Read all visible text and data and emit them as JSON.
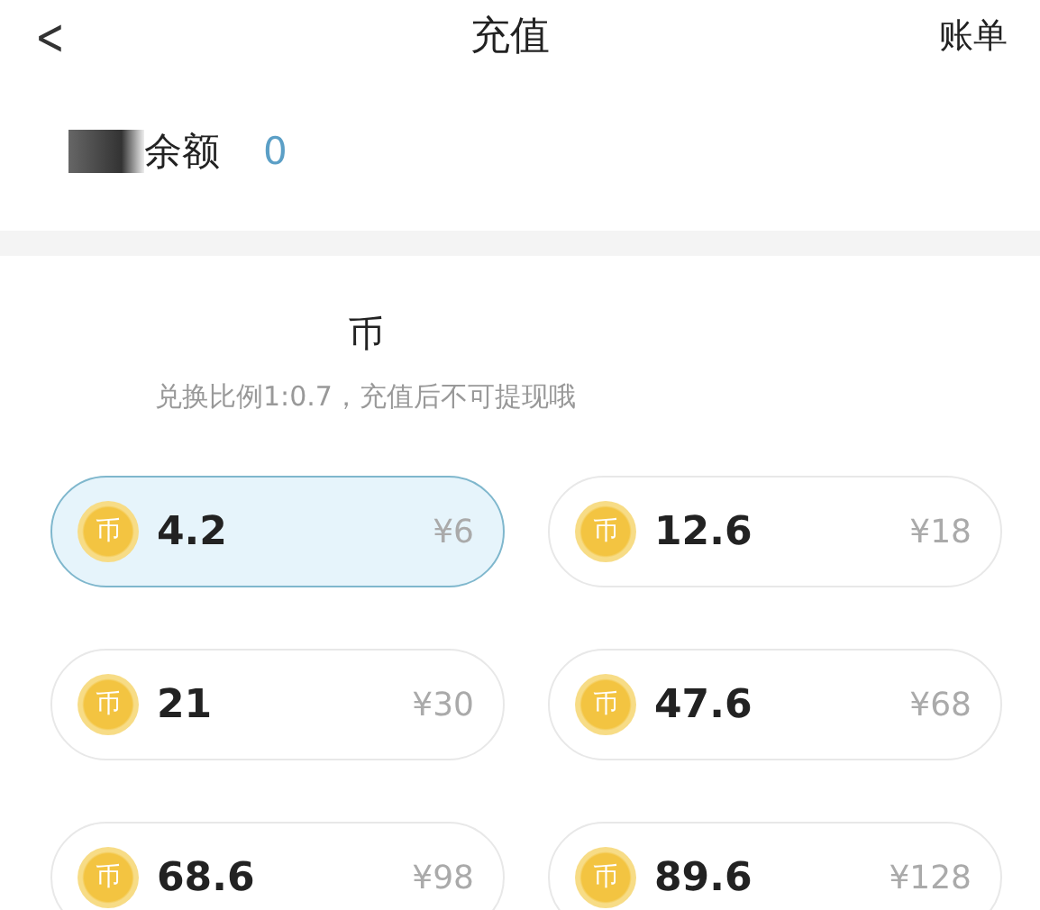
{
  "nav": {
    "back": "<",
    "title": "充值",
    "action": "账单"
  },
  "balance": {
    "label": "余额",
    "value": "0"
  },
  "recharge": {
    "title": "币",
    "note": "兑换比例1:0.7，充值后不可提现哦",
    "options": [
      {
        "icon_text": "币",
        "amount": "4.2",
        "price": "¥6",
        "selected": true
      },
      {
        "icon_text": "币",
        "amount": "12.6",
        "price": "¥18",
        "selected": false
      },
      {
        "icon_text": "币",
        "amount": "21",
        "price": "¥30",
        "selected": false
      },
      {
        "icon_text": "币",
        "amount": "47.6",
        "price": "¥68",
        "selected": false
      },
      {
        "icon_text": "币",
        "amount": "68.6",
        "price": "¥98",
        "selected": false
      },
      {
        "icon_text": "币",
        "amount": "89.6",
        "price": "¥128",
        "selected": false
      }
    ]
  }
}
